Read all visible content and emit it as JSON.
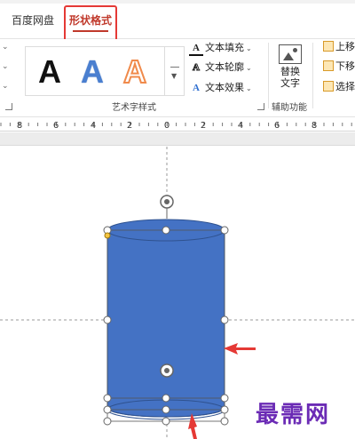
{
  "tabs": {
    "baidu": "百度网盘",
    "shape_format": "形状格式"
  },
  "art_styles": {
    "group_label": "艺术字样式",
    "samples": [
      "A",
      "A",
      "A"
    ]
  },
  "text_tools": {
    "fill": "文本填充",
    "outline": "文本轮廓",
    "effects": "文本效果"
  },
  "accessibility": {
    "replace_line1": "替换",
    "replace_line2": "文字",
    "group_label": "辅助功能"
  },
  "arrange": {
    "item1": "上移",
    "item2": "下移",
    "item3": "选择"
  },
  "ruler": {
    "labels": [
      "8",
      "6",
      "4",
      "2",
      "0",
      "2",
      "4",
      "6",
      "8"
    ]
  },
  "watermark": "最需网",
  "colors": {
    "accent_red": "#e53935",
    "shape_fill": "#4472c4",
    "shape_stroke": "#2f528f",
    "watermark": "#6b2bb5"
  }
}
